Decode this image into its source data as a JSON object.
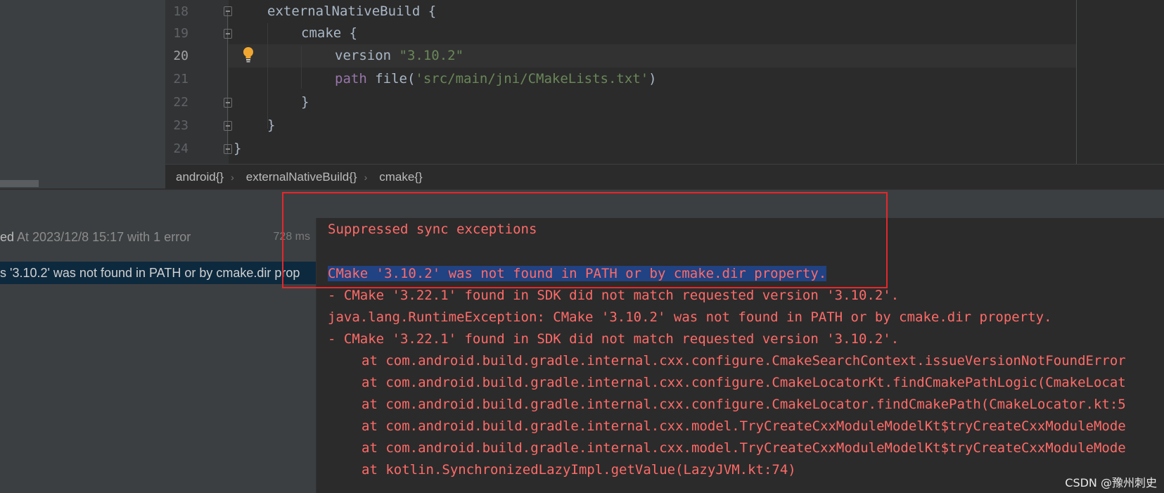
{
  "editor": {
    "lines": [
      {
        "num": "18",
        "code": "externalNativeBuild {"
      },
      {
        "num": "19",
        "code": "cmake {"
      },
      {
        "num": "20",
        "key": "version",
        "value": "\"3.10.2\""
      },
      {
        "num": "21",
        "key": "path",
        "fn": "file(",
        "value": "'src/main/jni/CMakeLists.txt'",
        "close": ")"
      },
      {
        "num": "22",
        "code": "}"
      },
      {
        "num": "23",
        "code": "}"
      },
      {
        "num": "24",
        "code": "}"
      }
    ],
    "current_line": "20",
    "bulb_icon": "lightbulb-icon"
  },
  "breadcrumb": [
    "android{}",
    "externalNativeBuild{}",
    "cmake{}"
  ],
  "build_tree": {
    "row1_status": "ed",
    "row1_text": " At 2023/12/8 15:17 with 1 error",
    "row1_time": "728 ms",
    "row2_text": "s '3.10.2' was not found in PATH or by cmake.dir prop"
  },
  "console": {
    "lines": [
      "Suppressed sync exceptions",
      "",
      "CMake '3.10.2' was not found in PATH or by cmake.dir property.",
      "- CMake '3.22.1' found in SDK did not match requested version '3.10.2'.",
      "java.lang.RuntimeException: CMake '3.10.2' was not found in PATH or by cmake.dir property.",
      "- CMake '3.22.1' found in SDK did not match requested version '3.10.2'.",
      "at com.android.build.gradle.internal.cxx.configure.CmakeSearchContext.issueVersionNotFoundError",
      "at com.android.build.gradle.internal.cxx.configure.CmakeLocatorKt.findCmakePathLogic(CmakeLocat",
      "at com.android.build.gradle.internal.cxx.configure.CmakeLocator.findCmakePath(CmakeLocator.kt:5",
      "at com.android.build.gradle.internal.cxx.model.TryCreateCxxModuleModelKt$tryCreateCxxModuleMode",
      "at com.android.build.gradle.internal.cxx.model.TryCreateCxxModuleModelKt$tryCreateCxxModuleMode",
      "at kotlin.SynchronizedLazyImpl.getValue(LazyJVM.kt:74)"
    ]
  },
  "colors": {
    "error_text": "#ff6b68",
    "highlight_box": "#e4282c",
    "selection": "#214283"
  },
  "watermark": "CSDN @豫州刺史"
}
